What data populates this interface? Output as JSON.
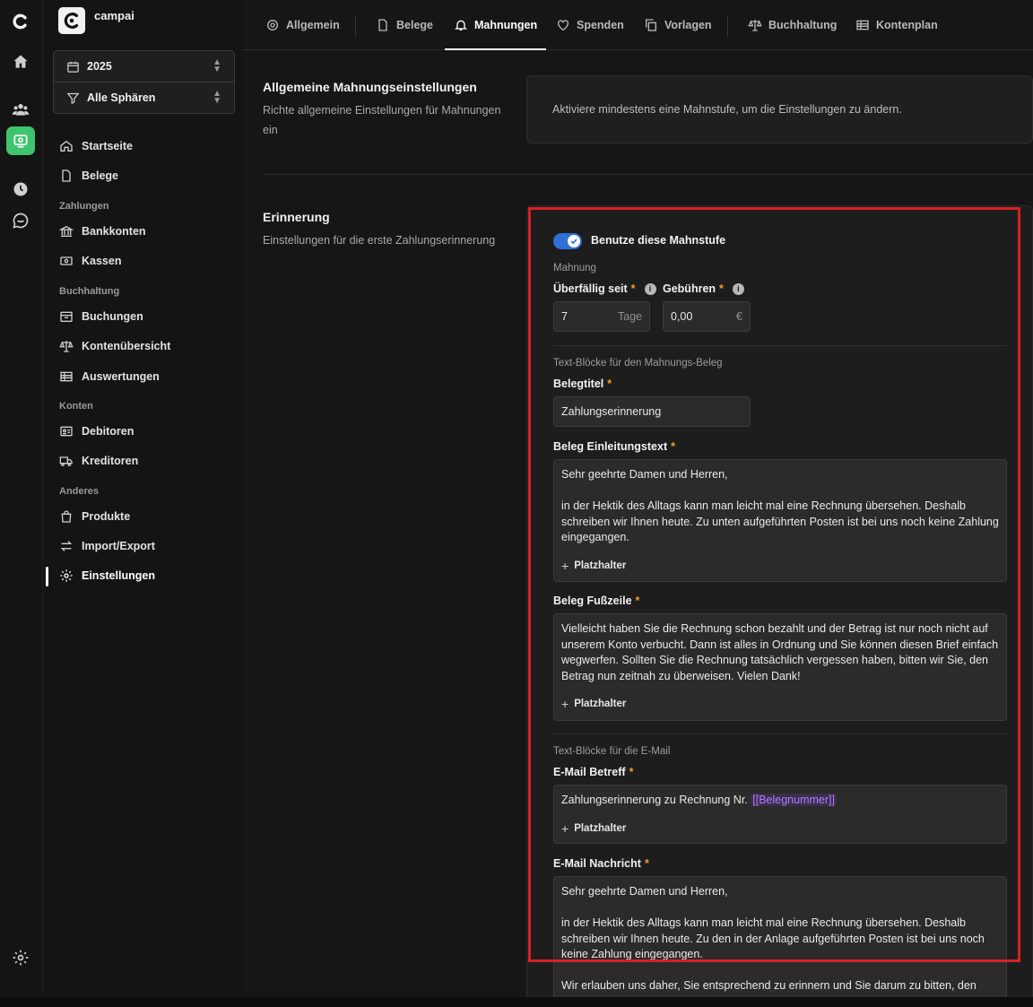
{
  "app": {
    "name": "campai"
  },
  "selectors": {
    "year": "2025",
    "sphere": "Alle Sphären"
  },
  "sidebar": {
    "items": [
      {
        "key": "startseite",
        "label": "Startseite",
        "icon": "home-icon"
      },
      {
        "key": "belege",
        "label": "Belege",
        "icon": "document-icon"
      }
    ],
    "groups": {
      "zahlungen": {
        "label": "Zahlungen",
        "items": [
          "Bankkonten",
          "Kassen"
        ]
      },
      "buchhaltung": {
        "label": "Buchhaltung",
        "items": [
          "Buchungen",
          "Kontenübersicht",
          "Auswertungen"
        ]
      },
      "konten": {
        "label": "Konten",
        "items": [
          "Debitoren",
          "Kreditoren"
        ]
      },
      "anderes": {
        "label": "Anderes",
        "items": [
          "Produkte",
          "Import/Export",
          "Einstellungen"
        ]
      }
    },
    "active": "Einstellungen"
  },
  "tabs": [
    "Allgemein",
    "Belege",
    "Mahnungen",
    "Spenden",
    "Vorlagen",
    "Buchhaltung",
    "Kontenplan"
  ],
  "active_tab": "Mahnungen",
  "general": {
    "title": "Allgemeine Mahnungseinstellungen",
    "description": "Richte allgemeine Einstellungen für Mahnungen ein",
    "info": "Aktiviere mindestens eine Mahnstufe, um die Einstellungen zu ändern."
  },
  "reminder": {
    "title": "Erinnerung",
    "description": "Einstellungen für die erste Zahlungserinnerung",
    "toggle_label": "Benutze diese Mahnstufe",
    "toggle_on": true,
    "mahnung_heading": "Mahnung",
    "overdue": {
      "label": "Überfällig seit",
      "value": "7",
      "suffix": "Tage"
    },
    "fees": {
      "label": "Gebühren",
      "value": "0,00",
      "suffix": "€"
    },
    "doc_blocks_heading": "Text-Blöcke für den Mahnungs-Beleg",
    "doc_title": {
      "label": "Belegtitel",
      "value": "Zahlungserinnerung"
    },
    "intro": {
      "label": "Beleg Einleitungstext",
      "p1": "Sehr geehrte Damen und Herren,",
      "p2": "in der Hektik des Alltags kann man leicht mal eine Rechnung übersehen. Deshalb schreiben wir Ihnen heute. Zu unten aufgeführten Posten ist bei uns noch keine Zahlung eingegangen."
    },
    "footer": {
      "label": "Beleg Fußzeile",
      "p1": "Vielleicht haben Sie die Rechnung schon bezahlt und der Betrag ist nur noch nicht auf unserem Konto verbucht. Dann ist alles in Ordnung und Sie können diesen Brief einfach wegwerfen. Sollten Sie die Rechnung tatsächlich vergessen haben, bitten wir Sie, den Betrag nun zeitnah zu überweisen. Vielen Dank!"
    },
    "placeholder_label": "Platzhalter",
    "email_blocks_heading": "Text-Blöcke für die E-Mail",
    "email_subject": {
      "label": "E-Mail Betreff",
      "text": "Zahlungserinnerung zu Rechnung Nr. ",
      "token": "[[Belegnummer]]"
    },
    "email_message": {
      "label": "E-Mail Nachricht",
      "p1": "Sehr geehrte Damen und Herren,",
      "p2": "in der Hektik des Alltags kann man leicht mal eine Rechnung übersehen. Deshalb schreiben wir Ihnen heute. Zu den in der Anlage aufgeführten Posten ist bei uns noch keine Zahlung eingegangen.",
      "p3": "Wir erlauben uns daher, Sie entsprechend zu erinnern und Sie darum zu bitten, den"
    }
  },
  "colors": {
    "accent_toggle": "#2f6fd6",
    "required": "#f0a020",
    "token": "#b47bff",
    "highlight": "#d81f26",
    "active_app": "#3ec46d"
  }
}
